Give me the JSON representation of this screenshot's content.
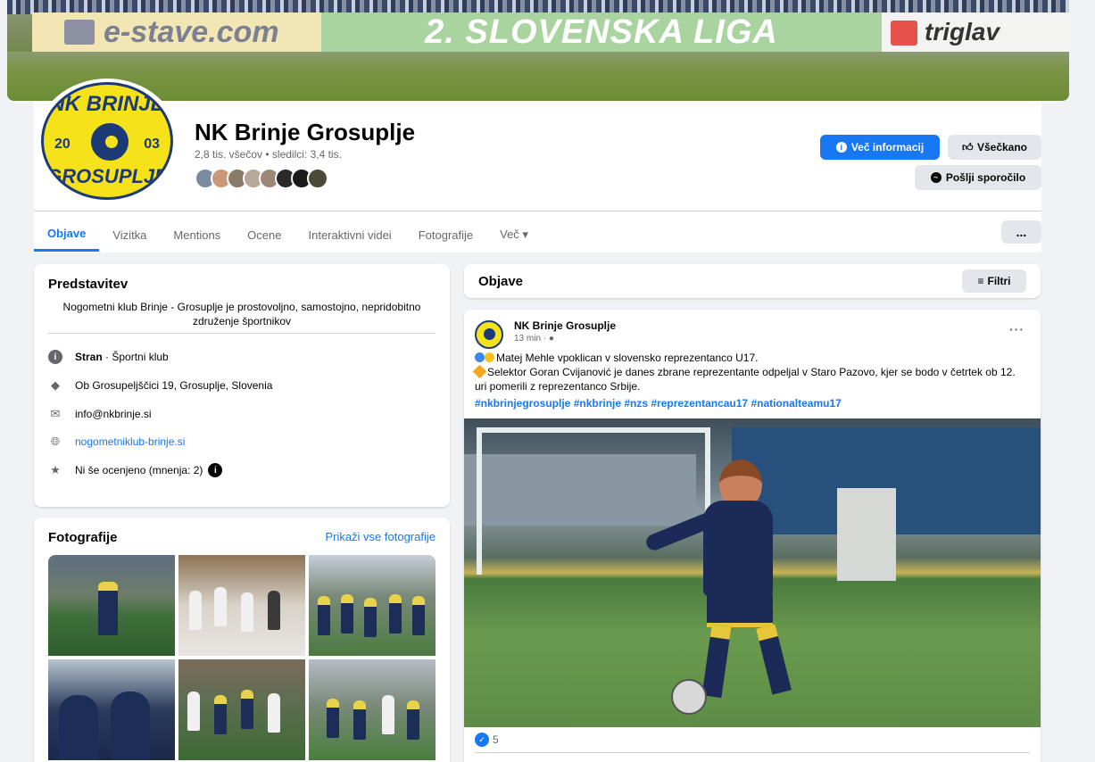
{
  "cover": {
    "estave": "e-stave.com",
    "liga": "2. SLOVENSKA LIGA",
    "liga_num": "2",
    "triglav": "triglav"
  },
  "profile": {
    "logo_top": "NK BRINJE",
    "logo_bottom": "GROSUPLJE",
    "logo_year_left": "20",
    "logo_year_right": "03",
    "name": "NK Brinje Grosuplje",
    "stats": "2,8 tis. všečov • sledilci: 3,4 tis."
  },
  "actions": {
    "info": "Več informacij",
    "like": "Všečkano",
    "message": "Pošlji sporočilo",
    "more": "..."
  },
  "tabs": [
    "Objave",
    "Vizitka",
    "Mentions",
    "Ocene",
    "Interaktivni videi",
    "Fotografije",
    "Več ▾"
  ],
  "intro": {
    "title": "Predstavitev",
    "text": "Nogometni klub Brinje - Grosuplje je prostovoljno, samostojno, nepridobitno združenje športnikov",
    "category_bold": "Stran",
    "category_rest": " · Športni klub",
    "address": "Ob Grosupeljščici 19, Grosuplje, Slovenia",
    "email": "info@nkbrinje.si",
    "website": "nogometniklub-brinje.si",
    "rating": "Ni še ocenjeno (mnenja: 2)"
  },
  "photos": {
    "title": "Fotografije",
    "link": "Prikaži vse fotografije"
  },
  "posts": {
    "header": "Objave",
    "filter": "Filtri",
    "author": "NK Brinje Grosuplje",
    "time": "13 min ·",
    "line1": "Matej Mehle vpoklican v slovensko reprezentanco U17.",
    "line2": "Selektor Goran Cvijanović je danes zbrane reprezentante odpeljal v Staro Pazovo, kjer se bodo v četrtek ob 12. uri pomerili z reprezentanco Srbije.",
    "hashtags": "#nkbrinjegrosuplje #nkbrinje #nzs #reprezentancau17 #nationalteamu17",
    "reactions": "5"
  },
  "colors": {
    "accent": "#1877f2",
    "club_yellow": "#f6e21a",
    "club_blue": "#1c3a78"
  }
}
